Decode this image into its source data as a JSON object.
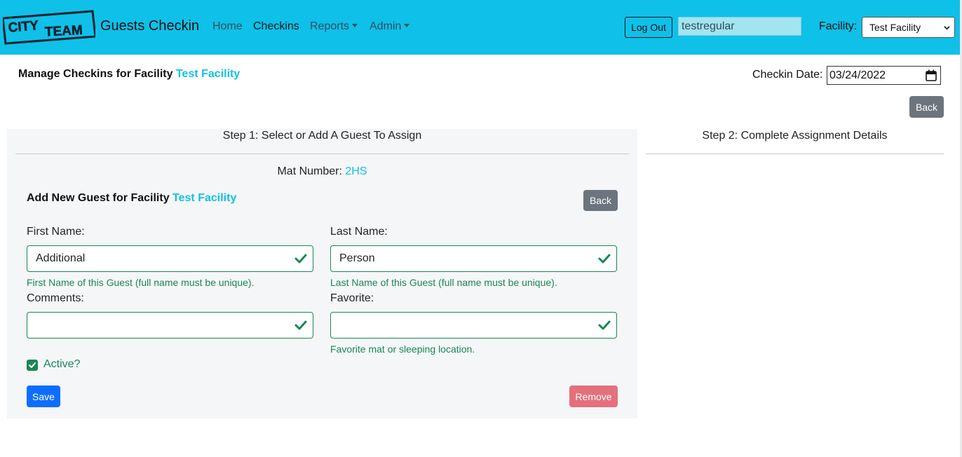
{
  "navbar": {
    "logo_text": "CITY TEAM",
    "brand": "Guests Checkin",
    "links": [
      {
        "label": "Home"
      },
      {
        "label": "Checkins"
      },
      {
        "label": "Reports"
      },
      {
        "label": "Admin"
      }
    ],
    "logout_label": "Log Out",
    "username": "testregular",
    "facility_label": "Facility:",
    "facility_selected": "Test Facility",
    "colors": {
      "navbar": "#0fc0e8",
      "accent": "#11c0e8"
    }
  },
  "header": {
    "title_prefix": "Manage Checkins for Facility",
    "facility": "Test Facility",
    "date_label": "Checkin Date:",
    "date_value": "03/24/2022",
    "back_label": "Back"
  },
  "step1": {
    "title": "Step 1: Select or Add A Guest To Assign",
    "mat_label": "Mat Number:",
    "mat_value": "2HS",
    "subtitle_prefix": "Add New Guest for Facility",
    "subtitle_facility": "Test Facility",
    "back_label": "Back",
    "first_name": {
      "label": "First Name:",
      "value": "Additional",
      "help": "First Name of this Guest (full name must be unique)."
    },
    "last_name": {
      "label": "Last Name:",
      "value": "Person",
      "help": "Last Name of this Guest (full name must be unique)."
    },
    "comments": {
      "label": "Comments:",
      "value": ""
    },
    "favorite": {
      "label": "Favorite:",
      "value": "",
      "help": "Favorite mat or sleeping location."
    },
    "active_label": "Active?",
    "active_checked": true,
    "save_label": "Save",
    "remove_label": "Remove",
    "colors": {
      "valid": "#198754",
      "save": "#0d6efd",
      "remove": "#e4707c"
    }
  },
  "step2": {
    "title": "Step 2: Complete Assignment Details"
  }
}
